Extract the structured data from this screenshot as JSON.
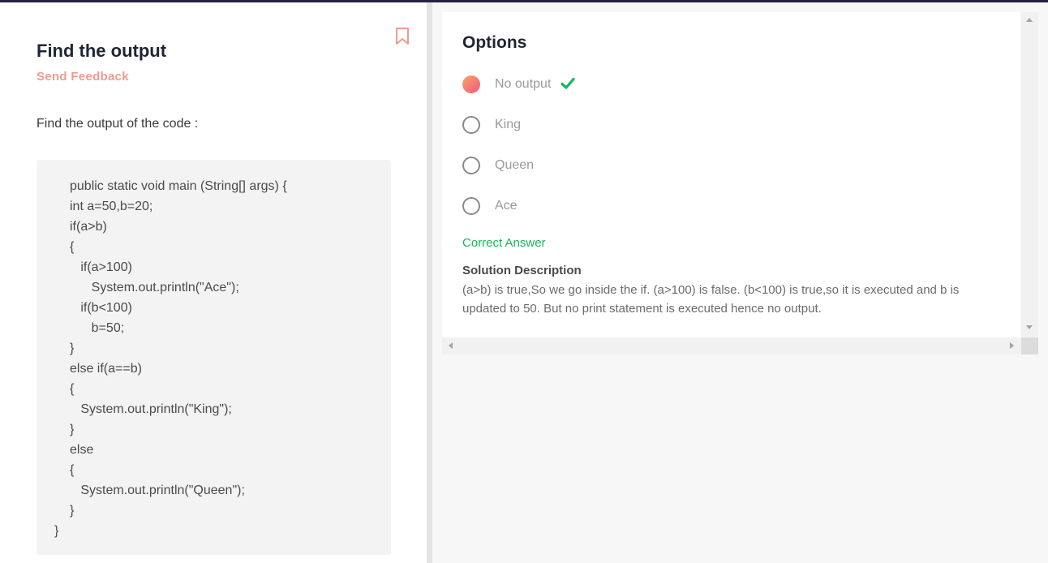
{
  "question": {
    "title": "Find the output",
    "feedback_label": "Send Feedback",
    "prompt": "Find the output of the code :",
    "code_lines": [
      "public static void main (String[] args) {",
      "int a=50,b=20;",
      "if(a>b)",
      "{",
      "   if(a>100)",
      "      System.out.println(\"Ace\");",
      "   if(b<100)",
      "      b=50;",
      "}",
      "else if(a==b)",
      "{",
      "   System.out.println(\"King\");",
      "}",
      "else",
      "{",
      "   System.out.println(\"Queen\");",
      "}",
      "}"
    ]
  },
  "options": {
    "title": "Options",
    "items": [
      {
        "label": "No output",
        "selected": true,
        "correct": true
      },
      {
        "label": "King",
        "selected": false,
        "correct": false
      },
      {
        "label": "Queen",
        "selected": false,
        "correct": false
      },
      {
        "label": "Ace",
        "selected": false,
        "correct": false
      }
    ],
    "correct_answer_label": "Correct Answer",
    "solution_title": "Solution Description",
    "solution_text": "(a>b) is true,So we go inside the if. (a>100) is false. (b<100) is true,so it is executed and b is updated to 50. But no print statement is executed hence no output."
  },
  "icons": {
    "bookmark": "bookmark-icon",
    "check": "check-icon"
  },
  "colors": {
    "accent": "#f19a8f",
    "correct": "#19b65a",
    "selected_gradient_start": "#f9a66a",
    "selected_gradient_end": "#f2577f",
    "heading": "#1f2533"
  }
}
